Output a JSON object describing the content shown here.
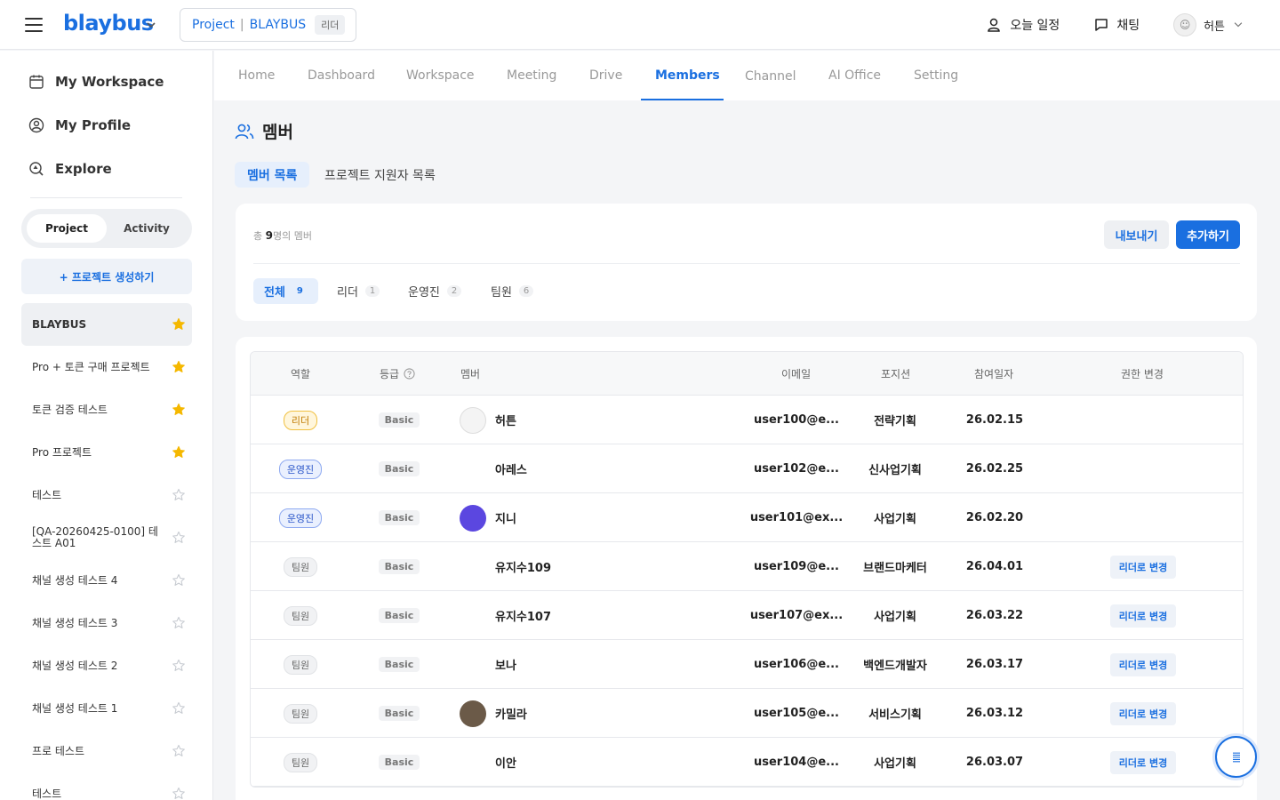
{
  "header": {
    "logo": "blaybus",
    "project_prefix": "Project",
    "project_name": "BLAYBUS",
    "project_role": "리더",
    "today_schedule": "오늘 일정",
    "chat": "채팅",
    "user_name": "허튼"
  },
  "sidebar": {
    "nav": [
      {
        "label": "My Workspace",
        "icon": "calendar-icon"
      },
      {
        "label": "My Profile",
        "icon": "user-circle-icon"
      },
      {
        "label": "Explore",
        "icon": "explore-icon"
      }
    ],
    "segment": {
      "project": "Project",
      "activity": "Activity"
    },
    "create_label": "+ 프로젝트 생성하기",
    "projects": [
      {
        "name": "BLAYBUS",
        "starred": true,
        "active": true
      },
      {
        "name": "Pro + 토큰 구매 프로젝트",
        "starred": true
      },
      {
        "name": "토큰 검증 테스트",
        "starred": true
      },
      {
        "name": "Pro 프로젝트",
        "starred": true
      },
      {
        "name": "테스트",
        "starred": false
      },
      {
        "name": "[QA-20260425-0100] 테스트 A01",
        "starred": false
      },
      {
        "name": "채널 생성 테스트 4",
        "starred": false
      },
      {
        "name": "채널 생성 테스트 3",
        "starred": false
      },
      {
        "name": "채널 생성 테스트 2",
        "starred": false
      },
      {
        "name": "채널 생성 테스트 1",
        "starred": false
      },
      {
        "name": "프로 테스트",
        "starred": false
      },
      {
        "name": "테스트",
        "starred": false
      }
    ]
  },
  "tabs": [
    "Home",
    "Dashboard",
    "Workspace",
    "Meeting",
    "Drive",
    "Members",
    "Channel",
    "AI Office",
    "Setting"
  ],
  "active_tab": "Members",
  "page": {
    "title": "멤버",
    "subtabs": [
      "멤버 목록",
      "프로젝트 지원자 목록"
    ]
  },
  "summary": {
    "prefix": "총",
    "count": "9",
    "suffix": "명의 멤버",
    "export_label": "내보내기",
    "add_label": "추가하기"
  },
  "filters": [
    {
      "label": "전체",
      "count": "9"
    },
    {
      "label": "리더",
      "count": "1"
    },
    {
      "label": "운영진",
      "count": "2"
    },
    {
      "label": "팀원",
      "count": "6"
    }
  ],
  "table": {
    "columns": [
      "역할",
      "등급",
      "멤버",
      "이메일",
      "포지션",
      "참여일자",
      "권한 변경"
    ],
    "rows": [
      {
        "role": "리더",
        "role_type": "leader",
        "grade": "Basic",
        "name": "허튼",
        "avatar": "gray",
        "email": "user100@e...",
        "position": "전략기획",
        "date": "26.02.15",
        "action": ""
      },
      {
        "role": "운영진",
        "role_type": "ops",
        "grade": "Basic",
        "name": "아레스",
        "avatar": "blaybus",
        "email": "user102@e...",
        "position": "신사업기획",
        "date": "26.02.25",
        "action": ""
      },
      {
        "role": "운영진",
        "role_type": "ops",
        "grade": "Basic",
        "name": "지니",
        "avatar": "purple",
        "email": "user101@ex...",
        "position": "사업기획",
        "date": "26.02.20",
        "action": ""
      },
      {
        "role": "팀원",
        "role_type": "member",
        "grade": "Basic",
        "name": "유지수109",
        "avatar": "blaybus",
        "email": "user109@e...",
        "position": "브랜드마케터",
        "date": "26.04.01",
        "action": "리더로 변경"
      },
      {
        "role": "팀원",
        "role_type": "member",
        "grade": "Basic",
        "name": "유지수107",
        "avatar": "blaybus",
        "email": "user107@ex...",
        "position": "사업기획",
        "date": "26.03.22",
        "action": "리더로 변경"
      },
      {
        "role": "팀원",
        "role_type": "member",
        "grade": "Basic",
        "name": "보나",
        "avatar": "blaybus",
        "email": "user106@e...",
        "position": "백엔드개발자",
        "date": "26.03.17",
        "action": "리더로 변경"
      },
      {
        "role": "팀원",
        "role_type": "member",
        "grade": "Basic",
        "name": "카밀라",
        "avatar": "photo",
        "email": "user105@e...",
        "position": "서비스기획",
        "date": "26.03.12",
        "action": "리더로 변경"
      },
      {
        "role": "팀원",
        "role_type": "member",
        "grade": "Basic",
        "name": "이안",
        "avatar": "blaybus",
        "email": "user104@e...",
        "position": "사업기획",
        "date": "26.03.07",
        "action": "리더로 변경"
      }
    ]
  },
  "colors": {
    "accent": "#1a6fe0",
    "star": "#f5b800"
  }
}
